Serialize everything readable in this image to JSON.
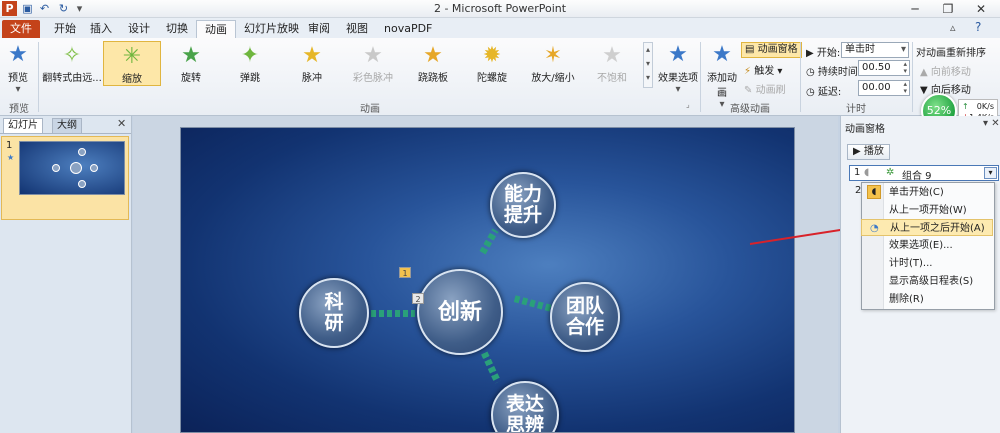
{
  "window": {
    "title": "2 - Microsoft PowerPoint",
    "app_icon": "P"
  },
  "tabs": [
    {
      "label": "文件"
    },
    {
      "label": "开始"
    },
    {
      "label": "插入"
    },
    {
      "label": "设计"
    },
    {
      "label": "切换"
    },
    {
      "label": "动画"
    },
    {
      "label": "幻灯片放映"
    },
    {
      "label": "审阅"
    },
    {
      "label": "视图"
    },
    {
      "label": "novaPDF"
    }
  ],
  "ribbon": {
    "preview_label": "预览",
    "preview_group": "预览",
    "animations": [
      "翻转式由远...",
      "缩放",
      "旋转",
      "弹跳",
      "脉冲",
      "彩色脉冲",
      "跷跷板",
      "陀螺旋",
      "放大/缩小",
      "不饱和"
    ],
    "effect_options": "效果选项",
    "animation_group": "动画",
    "add_animation": "添加动画",
    "animation_pane": "动画窗格",
    "trigger": "触发",
    "animation_painter": "动画刷",
    "advanced_group": "高级动画",
    "start_label": "开始:",
    "start_value": "单击时",
    "duration_label": "持续时间:",
    "duration_value": "00.50",
    "delay_label": "延迟:",
    "delay_value": "00.00",
    "timing_group": "计时",
    "reorder_title": "对动画重新排序",
    "move_earlier": "向前移动",
    "move_later": "向后移动",
    "speed_percent": "52%",
    "up_speed": "0K/s",
    "down_speed": "1.4K/s"
  },
  "leftpanel": {
    "tab_slides": "幻灯片",
    "tab_outline": "大纲",
    "slide_number": "1"
  },
  "slide": {
    "center": "创新",
    "top": "能力提升",
    "right": "团队合作",
    "left": "科研",
    "bottom": "表达思辨",
    "marker1": "1",
    "marker2": "2"
  },
  "pane": {
    "title": "动画窗格",
    "play": "播放",
    "item_index": "1",
    "item_name": "组合 9",
    "item2_index": "2",
    "menu": [
      "单击开始(C)",
      "从上一项开始(W)",
      "从上一项之后开始(A)",
      "效果选项(E)...",
      "计时(T)...",
      "显示高级日程表(S)",
      "删除(R)"
    ]
  }
}
